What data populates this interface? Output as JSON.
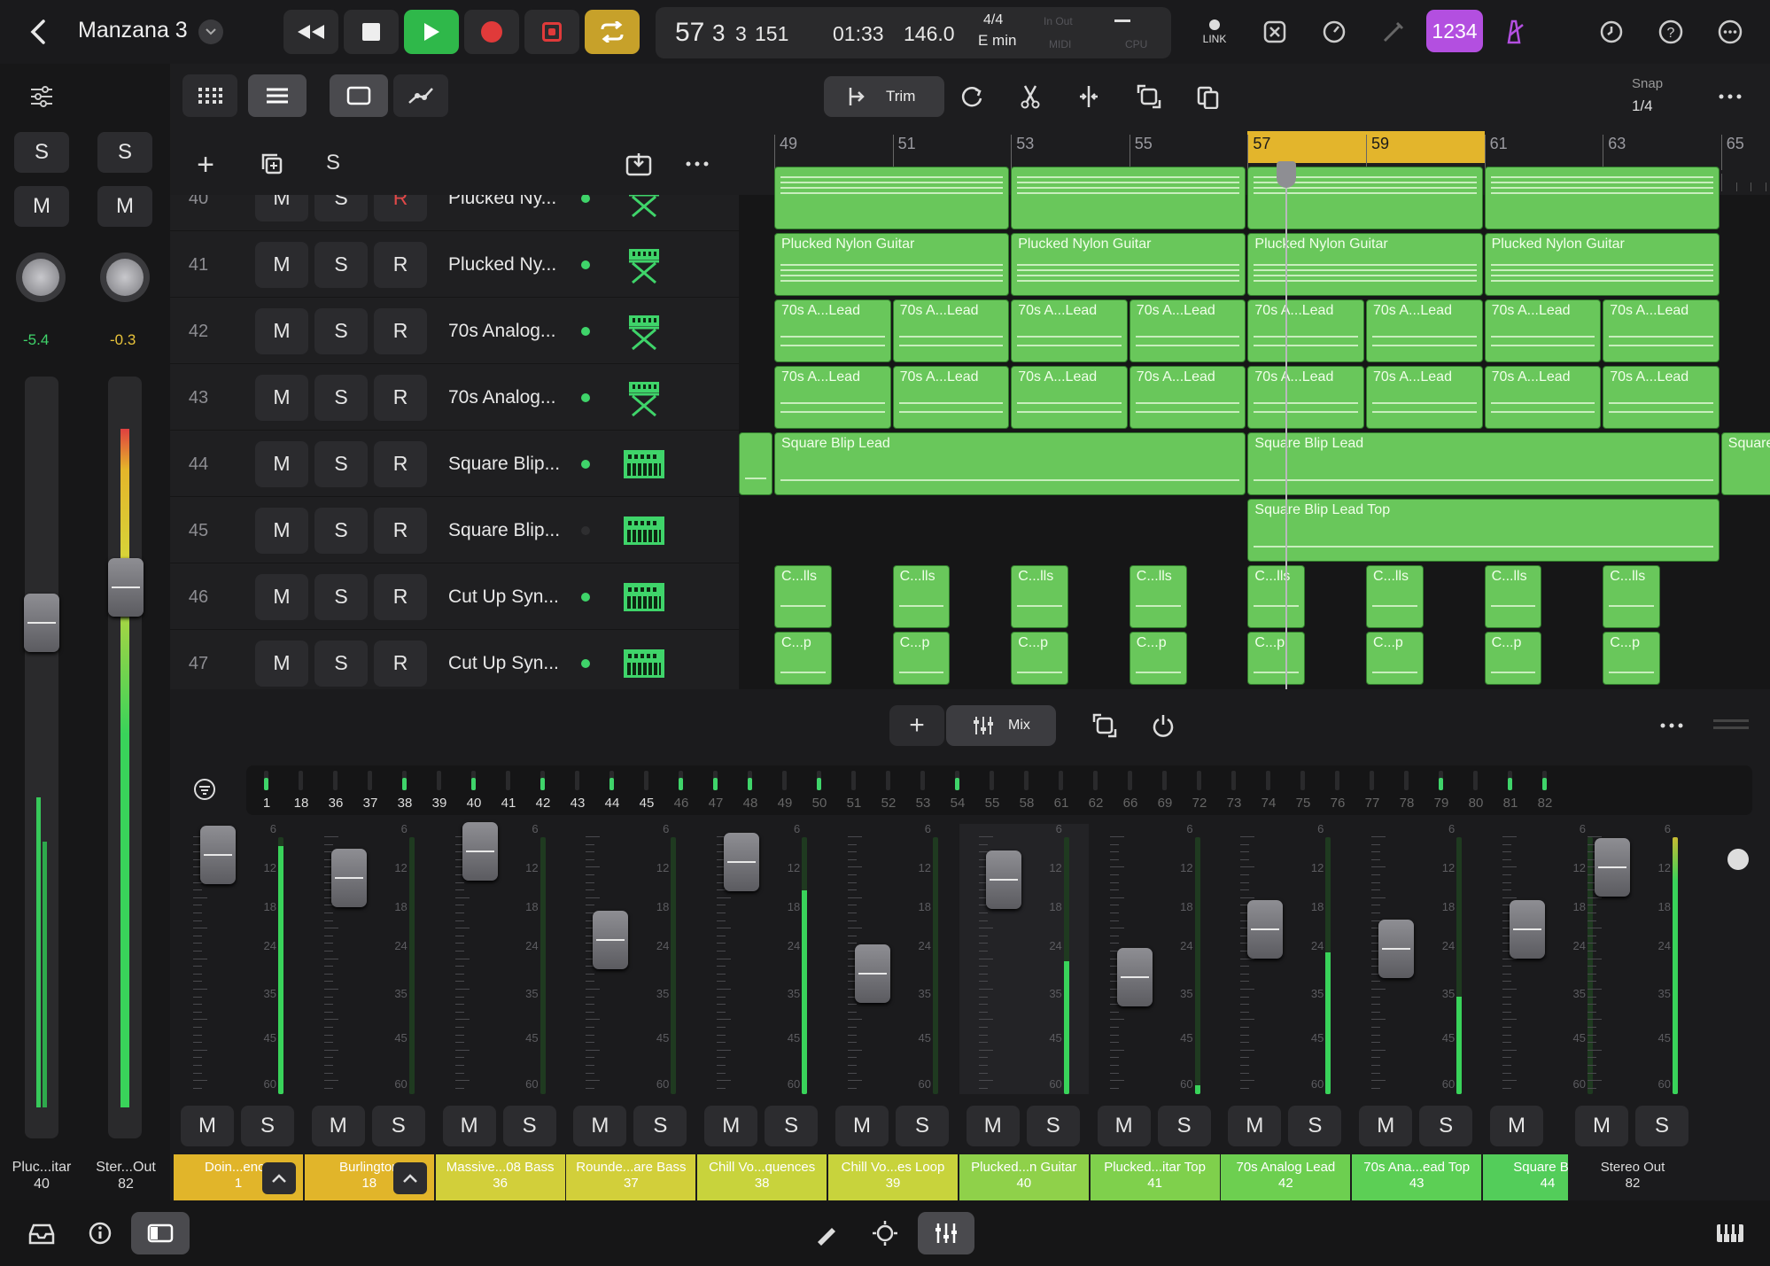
{
  "header": {
    "back": "<",
    "project": "Manzana 3",
    "position": {
      "bars": "57",
      "beat": "3",
      "div": "3",
      "ticks": "151"
    },
    "time": "01:33",
    "tempo": "146.0",
    "signature": "4/4",
    "key": "E min",
    "in_out": "In Out",
    "midi": "MIDI",
    "cpu": "CPU",
    "link": "LINK",
    "count_in": "1234"
  },
  "toolbar": {
    "trim": "Trim",
    "snap_label": "Snap",
    "snap_value": "1/4"
  },
  "track_header": {
    "add": "+",
    "solo": "S"
  },
  "ruler": [
    "49",
    "51",
    "53",
    "55",
    "57",
    "59",
    "61",
    "63",
    "65"
  ],
  "tracks": [
    {
      "num": "40",
      "name": "Plucked Ny...",
      "m": "M",
      "s": "S",
      "r": "R",
      "active": true,
      "instrument": "guitar-stand-icon"
    },
    {
      "num": "41",
      "name": "Plucked Ny...",
      "m": "M",
      "s": "S",
      "r": "R",
      "active": true,
      "instrument": "guitar-stand-icon"
    },
    {
      "num": "42",
      "name": "70s Analog...",
      "m": "M",
      "s": "S",
      "r": "R",
      "active": true,
      "instrument": "keyboard-stand-icon"
    },
    {
      "num": "43",
      "name": "70s Analog...",
      "m": "M",
      "s": "S",
      "r": "R",
      "active": true,
      "instrument": "keyboard-stand-icon"
    },
    {
      "num": "44",
      "name": "Square Blip...",
      "m": "M",
      "s": "S",
      "r": "R",
      "active": true,
      "instrument": "synth-icon"
    },
    {
      "num": "45",
      "name": "Square Blip...",
      "m": "M",
      "s": "S",
      "r": "R",
      "active": false,
      "instrument": "synth-icon"
    },
    {
      "num": "46",
      "name": "Cut Up Syn...",
      "m": "M",
      "s": "S",
      "r": "R",
      "active": true,
      "instrument": "synth-icon"
    },
    {
      "num": "47",
      "name": "Cut Up Syn...",
      "m": "M",
      "s": "S",
      "r": "R",
      "active": true,
      "instrument": "synth-icon"
    }
  ],
  "regions": {
    "guitar": "Plucked Nylon Guitar",
    "analog": "70s A...Lead",
    "blip": "Square Blip Lead",
    "blip_cut": "Square",
    "blip_top": "Square Blip Lead Top",
    "cells": "C...lls",
    "cp": "C...p"
  },
  "inspector": {
    "solo": "S",
    "mute": "M",
    "vol_left": "-5.4",
    "vol_right": "-0.3",
    "label_left": "Pluc...itar",
    "num_left": "40",
    "label_right": "Ster...Out",
    "num_right": "82"
  },
  "mixer_bar": {
    "add": "+",
    "mix": "Mix"
  },
  "overview": [
    "1",
    "18",
    "36",
    "37",
    "38",
    "39",
    "40",
    "41",
    "42",
    "43",
    "44",
    "45",
    "46",
    "47",
    "48",
    "49",
    "50",
    "51",
    "52",
    "53",
    "54",
    "55",
    "58",
    "61",
    "62",
    "66",
    "69",
    "72",
    "73",
    "74",
    "75",
    "76",
    "77",
    "78",
    "79",
    "80",
    "81",
    "82"
  ],
  "scale": [
    "6",
    "12",
    "18",
    "24",
    "35",
    "45",
    "60"
  ],
  "strips": [
    {
      "name": "Doin...ence",
      "num": "1",
      "m": "M",
      "s": "S",
      "color": "#e1b52a"
    },
    {
      "name": "Burlington",
      "num": "18",
      "m": "M",
      "s": "S",
      "color": "#e1b52a"
    },
    {
      "name": "Massive...08 Bass",
      "num": "36",
      "m": "M",
      "s": "S",
      "color": "#d2cf3a"
    },
    {
      "name": "Rounde...are Bass",
      "num": "37",
      "m": "M",
      "s": "S",
      "color": "#d2cf3a"
    },
    {
      "name": "Chill Vo...quences",
      "num": "38",
      "m": "M",
      "s": "S",
      "color": "#c8d33c"
    },
    {
      "name": "Chill Vo...es Loop",
      "num": "39",
      "m": "M",
      "s": "S",
      "color": "#c8d33c"
    },
    {
      "name": "Plucked...n Guitar",
      "num": "40",
      "m": "M",
      "s": "S",
      "color": "#8fd14a"
    },
    {
      "name": "Plucked...itar Top",
      "num": "41",
      "m": "M",
      "s": "S",
      "color": "#7fd04c"
    },
    {
      "name": "70s Analog Lead",
      "num": "42",
      "m": "M",
      "s": "S",
      "color": "#6dcf50"
    },
    {
      "name": "70s Ana...ead Top",
      "num": "43",
      "m": "M",
      "s": "S",
      "color": "#5ccf55"
    },
    {
      "name": "Square Blip",
      "num": "44",
      "m": "M",
      "s": "S",
      "color": "#53cd5a"
    },
    {
      "name": "Stereo Out",
      "num": "82",
      "m": "M",
      "s": "S",
      "color": "#1b1b1d"
    }
  ]
}
